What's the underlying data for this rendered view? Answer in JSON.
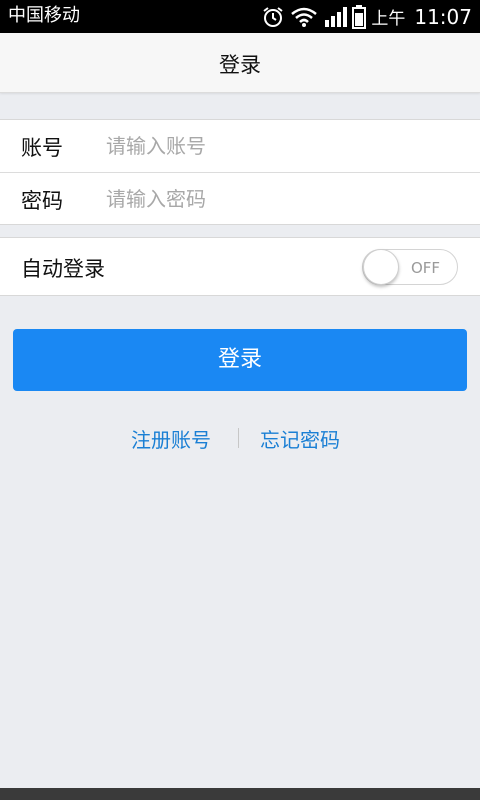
{
  "status_bar": {
    "carrier": "中国移动",
    "ampm": "上午",
    "time": "11:07",
    "icons": [
      "alarm-icon",
      "wifi-icon",
      "signal-icon",
      "battery-icon"
    ]
  },
  "nav": {
    "title": "登录"
  },
  "form": {
    "account_label": "账号",
    "account_placeholder": "请输入账号",
    "account_value": "",
    "password_label": "密码",
    "password_placeholder": "请输入密码",
    "password_value": ""
  },
  "auto_login": {
    "label": "自动登录",
    "toggle_text": "OFF",
    "enabled": false
  },
  "actions": {
    "login_button": "登录",
    "register_link": "注册账号",
    "forgot_link": "忘记密码"
  },
  "colors": {
    "accent": "#1a88f3",
    "link": "#1a7fd4",
    "background": "#ebedf1"
  }
}
